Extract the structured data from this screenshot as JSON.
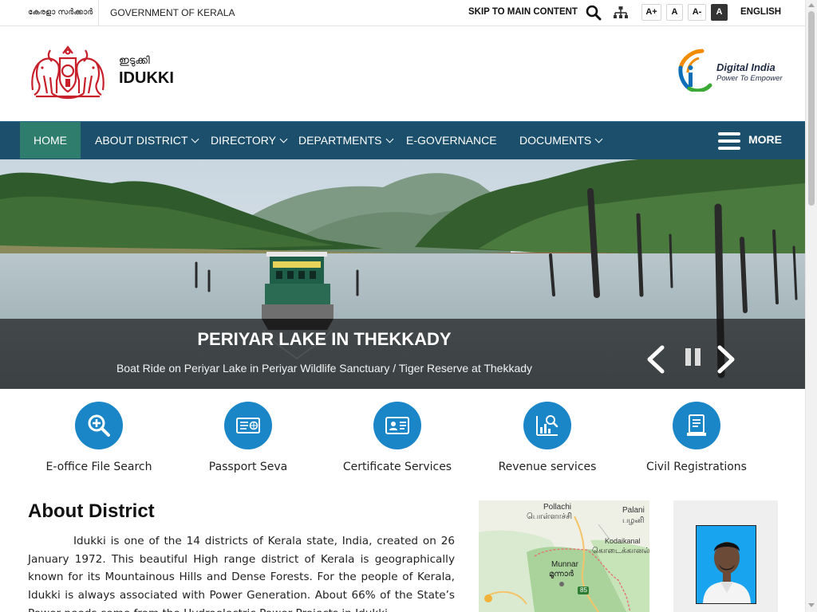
{
  "topbar": {
    "state_name_mal": "കേരളാ സർക്കാർ",
    "gov_label": "GOVERNMENT OF KERALA",
    "skip_label": "SKIP TO MAIN CONTENT",
    "font_increase": "A+",
    "font_normal": "A",
    "font_decrease": "A-",
    "high_contrast": "A",
    "language": "ENGLISH"
  },
  "header": {
    "site_name_mal": "ഇടുക്കി",
    "site_name": "IDUKKI",
    "partner_logo": {
      "title": "Digital India",
      "tagline": "Power To Empower"
    }
  },
  "nav": {
    "items": [
      {
        "label": "HOME",
        "active": true
      },
      {
        "label": "ABOUT DISTRICT",
        "dropdown": true
      },
      {
        "label": "DIRECTORY",
        "dropdown": true
      },
      {
        "label": "DEPARTMENTS",
        "dropdown": true
      },
      {
        "label": "E-GOVERNANCE"
      },
      {
        "label": "DOCUMENTS",
        "dropdown": true
      }
    ],
    "more_label": "MORE"
  },
  "banner": {
    "title": "PERIYAR LAKE IN THEKKADY",
    "subtitle": "Boat Ride on Periyar Lake in Periyar Wildlife Sanctuary / Tiger Reserve at Thekkady"
  },
  "services": [
    {
      "label": "E-office File Search",
      "icon": "search-plus-icon"
    },
    {
      "label": "Passport Seva",
      "icon": "passport-card-icon"
    },
    {
      "label": "Certificate Services",
      "icon": "id-card-icon"
    },
    {
      "label": "Revenue services",
      "icon": "revenue-chart-icon"
    },
    {
      "label": "Civil Registrations",
      "icon": "registration-document-icon"
    }
  ],
  "about": {
    "title": "About District",
    "text": "Idukki is one of the 14 districts of Kerala state, India, created on 26 January 1972. This beautiful High range district of Kerala is geographically known for its Mountainous Hills and Dense Forests. For the people of Kerala, Idukki is always associated with Power Generation. About 66% of the State’s Power needs come from the Hydroelectric Power Projects in Idukki."
  },
  "map": {
    "labels": {
      "pollachi": "Pollachi",
      "pollachi_tamil": "பொள்ளாச்சி",
      "palani": "Palani",
      "palani_tamil": "பழனி",
      "kodaikanal": "Kodaikanal",
      "kodaikanal_tamil": "கொடைக்கானல்",
      "munnar": "Munnar",
      "munnar_mal": "മൂന്നാർ",
      "road_85": "85"
    }
  },
  "colors": {
    "nav_bg": "#1b4f6b",
    "nav_active": "#2f7d6d",
    "service_circle": "#1a86c8",
    "caption_band": "rgba(20,20,20,0.68)"
  }
}
